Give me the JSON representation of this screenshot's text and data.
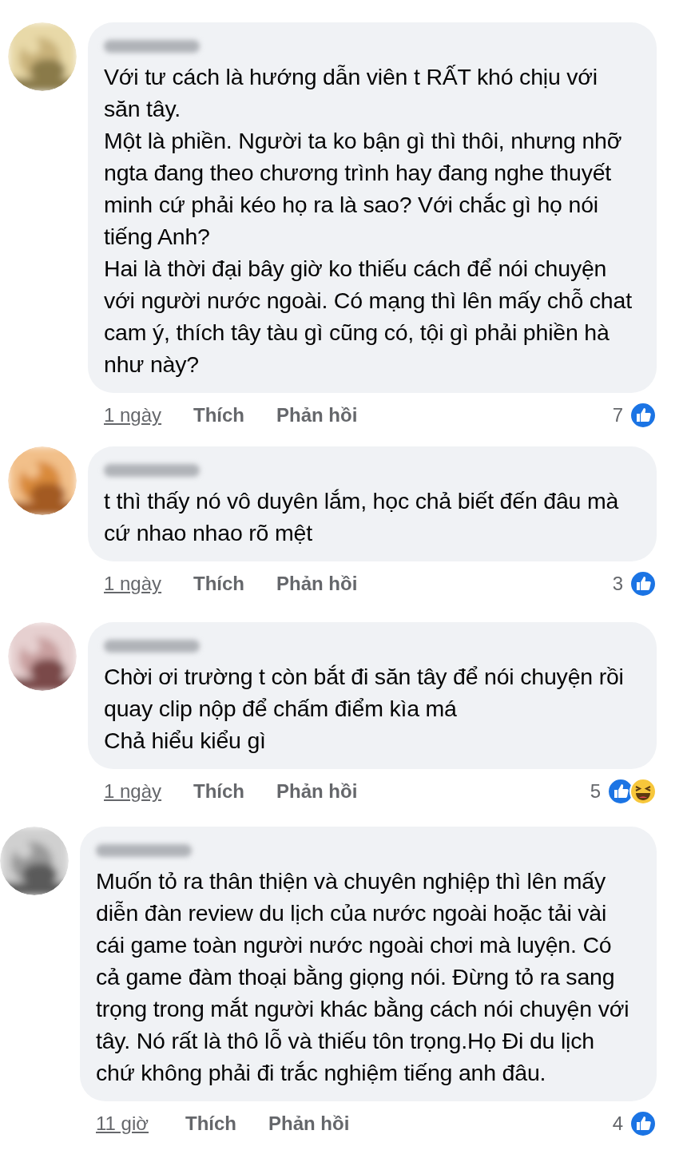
{
  "comments": [
    {
      "paragraphs": [
        "Với tư cách là hướng dẫn viên t RẤT khó chịu với săn tây.",
        "Một là phiền. Người ta ko bận gì thì thôi, nhưng nhỡ ngta đang theo chương trình hay đang nghe thuyết minh cứ phải kéo họ ra là sao? Với chắc gì họ nói tiếng Anh?",
        "Hai là thời đại bây giờ ko thiếu cách để nói chuyện với người nước ngoài. Có mạng thì lên mấy chỗ chat cam ý, thích tây tàu gì cũng có, tội gì phải phiền hà như này?"
      ],
      "time": "1 ngày",
      "like": "Thích",
      "reply": "Phản hồi",
      "count": "7",
      "reactions": [
        {
          "kind": "like"
        }
      ]
    },
    {
      "paragraphs": [
        "t thì thấy nó vô duyên lắm, học chả biết đến đâu mà cứ nhao nhao rõ mệt"
      ],
      "time": "1 ngày",
      "like": "Thích",
      "reply": "Phản hồi",
      "count": "3",
      "reactions": [
        {
          "kind": "like"
        }
      ]
    },
    {
      "paragraphs": [
        "Chời ơi trường t còn bắt đi săn tây để nói chuyện rồi quay clip nộp để chấm điểm kìa má",
        "Chả hiểu kiểu gì"
      ],
      "time": "1 ngày",
      "like": "Thích",
      "reply": "Phản hồi",
      "count": "5",
      "reactions": [
        {
          "kind": "like"
        },
        {
          "kind": "haha"
        }
      ]
    },
    {
      "paragraphs": [
        "Muốn tỏ ra thân thiện và chuyên nghiệp thì lên mấy diễn đàn review du lịch của nước ngoài hoặc tải vài cái game toàn người nước ngoài chơi mà luyện. Có cả game đàm thoại bằng giọng nói. Đừng tỏ ra sang trọng trong mắt người khác bằng cách nói chuyện với tây. Nó rất là thô lỗ và thiếu tôn trọng.Họ Đi du lịch chứ không phải đi trắc nghiệm tiếng anh đâu."
      ],
      "time": "11 giờ",
      "like": "Thích",
      "reply": "Phản hồi",
      "count": "4",
      "reactions": [
        {
          "kind": "like"
        }
      ]
    }
  ]
}
